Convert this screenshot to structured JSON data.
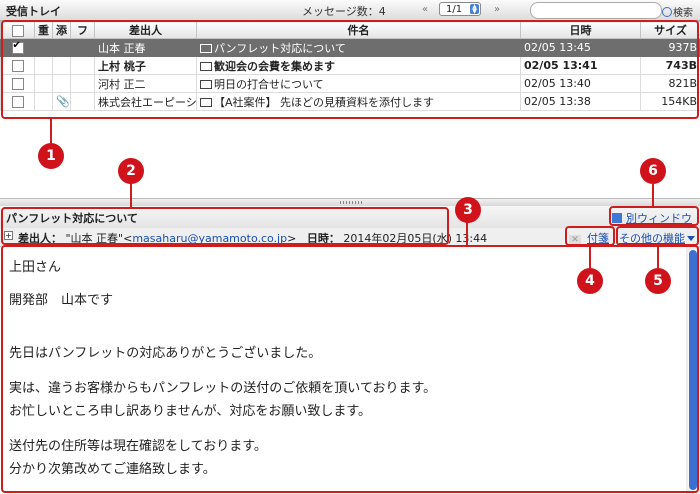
{
  "toolbar": {
    "title": "受信トレイ",
    "message_count": "メッセージ数：4",
    "prev_label": "«",
    "next_label": "»",
    "page": "1/1",
    "search_label": "検索"
  },
  "table": {
    "headers": [
      "",
      "重",
      "添",
      "フ",
      "差出人",
      "件名",
      "日時",
      "サイズ"
    ],
    "rows": [
      {
        "checked": true,
        "selected": true,
        "unread": false,
        "attachment": false,
        "sender": "山本 正春",
        "subject": "パンフレット対応について",
        "date": "02/05 13:45",
        "size": "937B"
      },
      {
        "checked": false,
        "selected": false,
        "unread": true,
        "attachment": false,
        "sender": "上村 桃子",
        "subject": "歓迎会の会費を集めます",
        "date": "02/05 13:41",
        "size": "743B"
      },
      {
        "checked": false,
        "selected": false,
        "unread": false,
        "attachment": false,
        "sender": "河村 正二",
        "subject": "明日の打合せについて",
        "date": "02/05 13:40",
        "size": "821B"
      },
      {
        "checked": false,
        "selected": false,
        "unread": false,
        "attachment": true,
        "sender": "株式会社エーピーシ",
        "subject": "【A社案件】 先ほどの見積資料を添付します",
        "date": "02/05 13:38",
        "size": "154KB"
      }
    ]
  },
  "preview": {
    "subject": "パンフレット対応について",
    "new_window": "別ウィンドウ",
    "from_label": "差出人：",
    "from_name": "\"山本 正春\"<",
    "from_email": "masaharu@yamamoto.co.jp",
    "from_close": ">",
    "date_label": "日時：",
    "date_value": "2014年02月05日(水) 13:44",
    "memo": "付箋",
    "other": "その他の機能",
    "body": [
      "上田さん",
      "開発部　山本です",
      "先日はパンフレットの対応ありがとうございました。",
      "実は、違うお客様からもパンフレットの送付のご依頼を頂いております。",
      "お忙しいところ申し訳ありませんが、対応をお願い致します。",
      "送付先の住所等は現在確認をしております。",
      "分かり次第改めてご連絡致します。"
    ]
  },
  "callouts": [
    "1",
    "2",
    "3",
    "4",
    "5",
    "6"
  ],
  "colors": {
    "callout": "#cc1e1e",
    "selected_row": "#6e6e6e",
    "link": "#1a4fb5"
  }
}
